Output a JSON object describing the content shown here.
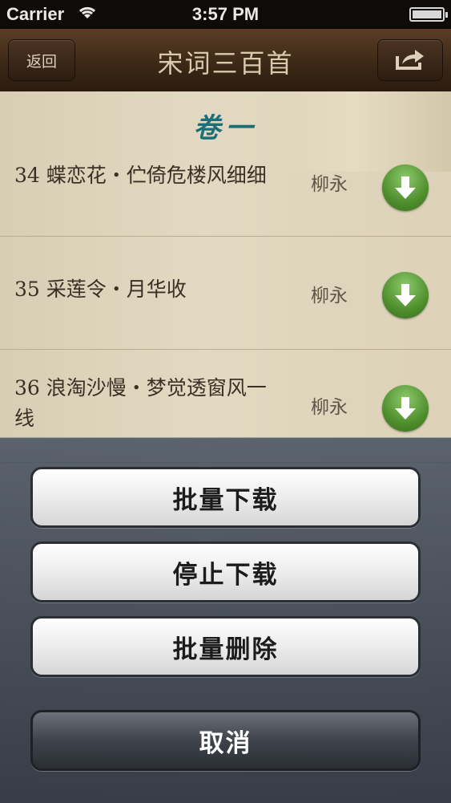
{
  "status_bar": {
    "carrier": "Carrier",
    "time": "3:57 PM"
  },
  "nav": {
    "back_label": "返回",
    "title": "宋词三百首"
  },
  "section_title": "卷一",
  "poems": [
    {
      "text": "34  蝶恋花・伫倚危楼风细细",
      "author": "柳永"
    },
    {
      "text": "35  采莲令・月华收",
      "author": "柳永"
    },
    {
      "text": "36  浪淘沙慢・梦觉透窗风一线",
      "author": "柳永"
    }
  ],
  "action_sheet": {
    "batch_download": "批量下载",
    "stop_download": "停止下载",
    "batch_delete": "批量删除",
    "cancel": "取消"
  },
  "colors": {
    "download_button": "#4f8f2c",
    "section_title": "#1c6f78",
    "nav_bar": "#3a2716"
  }
}
